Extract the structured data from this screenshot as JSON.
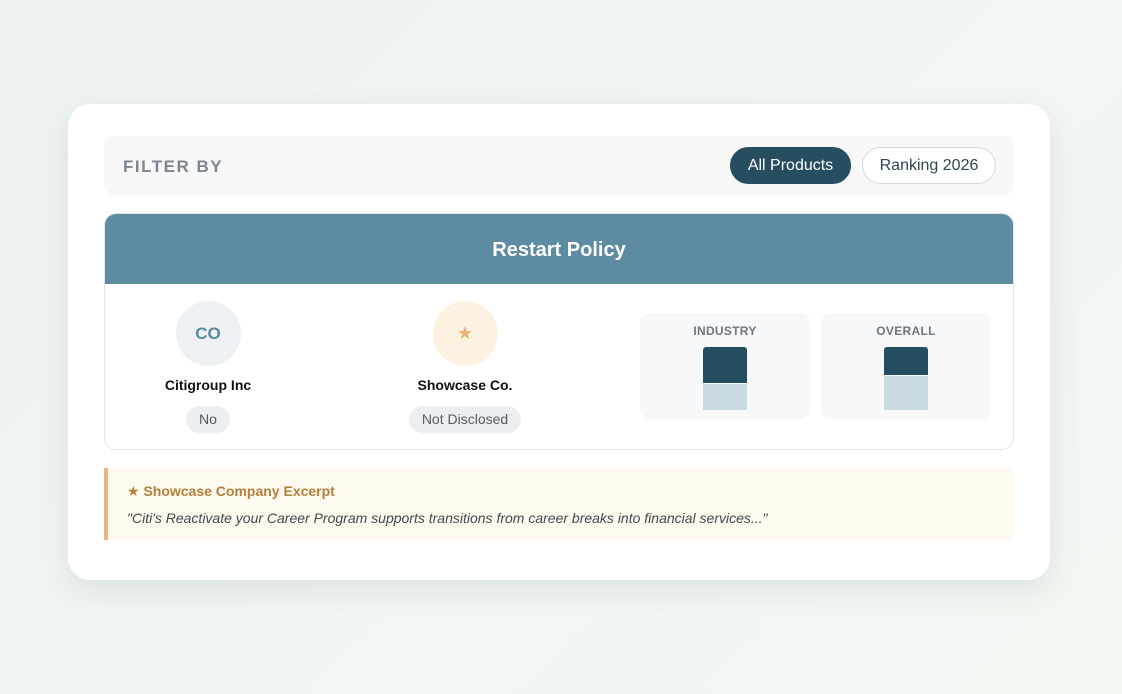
{
  "filter": {
    "label": "FILTER BY",
    "options": [
      {
        "label": "All Products",
        "active": true
      },
      {
        "label": "Ranking 2026",
        "active": false
      }
    ]
  },
  "policy": {
    "title": "Restart Policy",
    "companies": [
      {
        "initials": "CO",
        "name": "Citigroup Inc",
        "value": "No"
      },
      {
        "icon": "star-icon",
        "glyph": "★",
        "name": "Showcase Co.",
        "value": "Not Disclosed"
      }
    ],
    "stats": [
      {
        "title": "INDUSTRY",
        "dark_fraction": 0.57
      },
      {
        "title": "OVERALL",
        "dark_fraction": 0.45
      }
    ]
  },
  "excerpt": {
    "title": "★ Showcase Company Excerpt",
    "text": "\"Citi's Reactivate your Career Program supports transitions from career breaks into financial services...\""
  },
  "colors": {
    "primary": "#274d60",
    "header": "#5d8ca2",
    "accent": "#e7b57d",
    "bar_light": "#c9dbe2"
  }
}
